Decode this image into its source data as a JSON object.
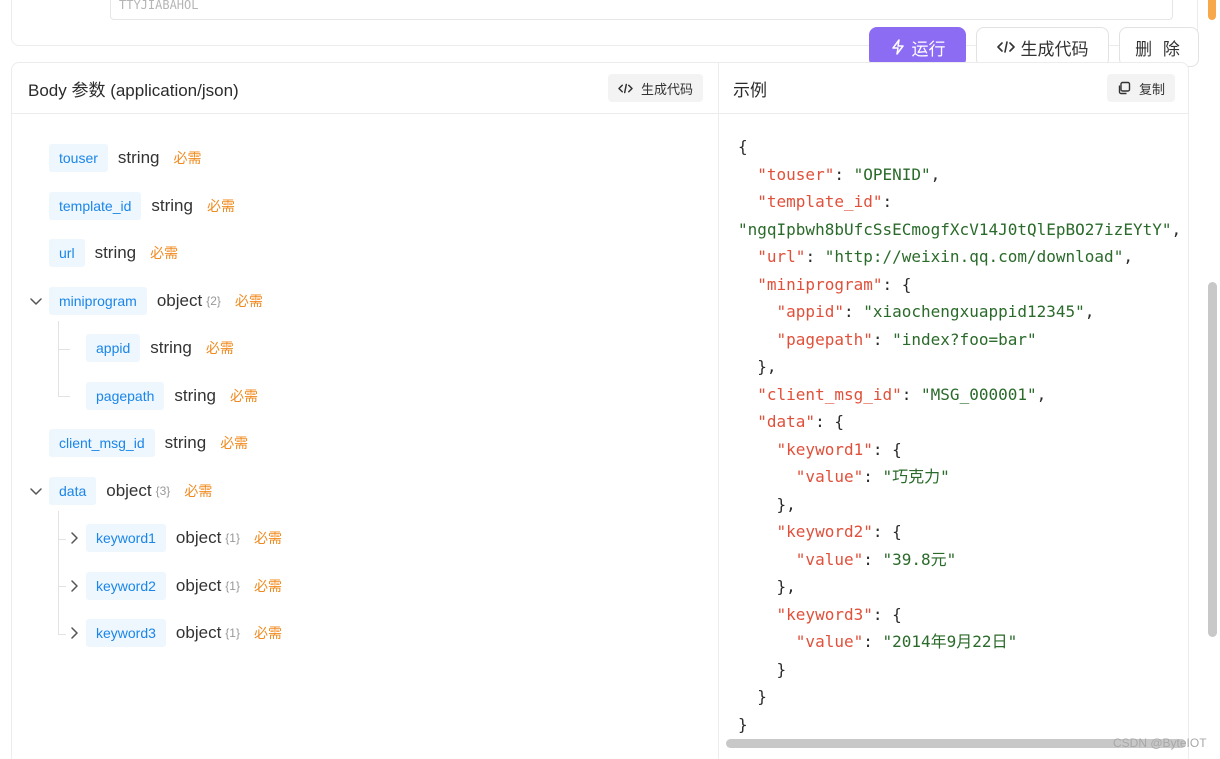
{
  "top": {
    "input_value": "TTYJIABAHOL"
  },
  "actions": {
    "run": "运行",
    "generate": "生成代码",
    "delete": "删 除"
  },
  "left": {
    "title": "Body 参数 (application/json)",
    "gen_btn": "生成代码",
    "fields": [
      {
        "name": "touser",
        "type": "string",
        "count": "",
        "required": "必需"
      },
      {
        "name": "template_id",
        "type": "string",
        "count": "",
        "required": "必需"
      },
      {
        "name": "url",
        "type": "string",
        "count": "",
        "required": "必需"
      },
      {
        "name": "miniprogram",
        "type": "object",
        "count": "{2}",
        "required": "必需"
      },
      {
        "name": "appid",
        "type": "string",
        "count": "",
        "required": "必需"
      },
      {
        "name": "pagepath",
        "type": "string",
        "count": "",
        "required": "必需"
      },
      {
        "name": "client_msg_id",
        "type": "string",
        "count": "",
        "required": "必需"
      },
      {
        "name": "data",
        "type": "object",
        "count": "{3}",
        "required": "必需"
      },
      {
        "name": "keyword1",
        "type": "object",
        "count": "{1}",
        "required": "必需"
      },
      {
        "name": "keyword2",
        "type": "object",
        "count": "{1}",
        "required": "必需"
      },
      {
        "name": "keyword3",
        "type": "object",
        "count": "{1}",
        "required": "必需"
      }
    ]
  },
  "right": {
    "title": "示例",
    "copy_btn": "复制",
    "code": {
      "open": "{",
      "l1k": "\"touser\"",
      "l1v": "\"OPENID\"",
      "l2k": "\"template_id\"",
      "l3v": "\"ngqIpbwh8bUfcSsECmogfXcV14J0tQlEpBO27izEYtY\"",
      "l4k": "\"url\"",
      "l4v": "\"http://weixin.qq.com/download\"",
      "l5k": "\"miniprogram\"",
      "l6k": "\"appid\"",
      "l6v": "\"xiaochengxuappid12345\"",
      "l7k": "\"pagepath\"",
      "l7v": "\"index?foo=bar\"",
      "l9k": "\"client_msg_id\"",
      "l9v": "\"MSG_000001\"",
      "l10k": "\"data\"",
      "l11k": "\"keyword1\"",
      "l12k": "\"value\"",
      "l12v": "\"巧克力\"",
      "l14k": "\"keyword2\"",
      "l15k": "\"value\"",
      "l15v": "\"39.8元\"",
      "l17k": "\"keyword3\"",
      "l18k": "\"value\"",
      "l18v": "\"2014年9月22日\"",
      "close": "}"
    }
  },
  "watermark": "CSDN @ByteIOT"
}
